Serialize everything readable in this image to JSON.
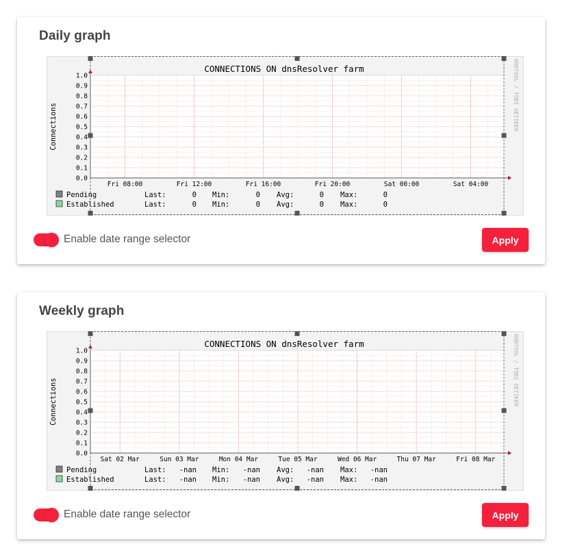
{
  "panels": [
    {
      "title": "Daily graph",
      "graph_title": "CONNECTIONS ON dnsResolver farm",
      "ylabel": "Connections",
      "watermark": "RRDTOOL / TOBI OETIKER",
      "toggle_label": "Enable date range selector",
      "toggle_on": true,
      "apply_label": "Apply",
      "legend": [
        {
          "name": "Pending",
          "color": "#808080",
          "last_label": "Last:",
          "last": "0",
          "min_label": "Min:",
          "min": "0",
          "avg_label": "Avg:",
          "avg": "0",
          "max_label": "Max:",
          "max": "0"
        },
        {
          "name": "Established",
          "color": "#88d8a0",
          "last_label": "Last:",
          "last": "0",
          "min_label": "Min:",
          "min": "0",
          "avg_label": "Avg:",
          "avg": "0",
          "max_label": "Max:",
          "max": "0"
        }
      ]
    },
    {
      "title": "Weekly graph",
      "graph_title": "CONNECTIONS ON dnsResolver farm",
      "ylabel": "Connections",
      "watermark": "RRDTOOL / TOBI OETIKER",
      "toggle_label": "Enable date range selector",
      "toggle_on": true,
      "apply_label": "Apply",
      "legend": [
        {
          "name": "Pending",
          "color": "#808080",
          "last_label": "Last:",
          "last": "-nan",
          "min_label": "Min:",
          "min": "-nan",
          "avg_label": "Avg:",
          "avg": "-nan",
          "max_label": "Max:",
          "max": "-nan"
        },
        {
          "name": "Established",
          "color": "#88d8a0",
          "last_label": "Last:",
          "last": "-nan",
          "min_label": "Min:",
          "min": "-nan",
          "avg_label": "Avg:",
          "avg": "-nan",
          "max_label": "Max:",
          "max": "-nan"
        }
      ]
    }
  ],
  "chart_data": [
    {
      "type": "area",
      "title": "CONNECTIONS ON dnsResolver farm",
      "ylabel": "Connections",
      "xlabel": "",
      "ylim": [
        0,
        1
      ],
      "yticks": [
        "0.0",
        "0.1",
        "0.2",
        "0.3",
        "0.4",
        "0.5",
        "0.6",
        "0.7",
        "0.8",
        "0.9",
        "1.0"
      ],
      "xticks": [
        "Fri 08:00",
        "Fri 12:00",
        "Fri 16:00",
        "Fri 20:00",
        "Sat 00:00",
        "Sat 04:00"
      ],
      "series": [
        {
          "name": "Pending",
          "color": "#808080",
          "values": []
        },
        {
          "name": "Established",
          "color": "#88d8a0",
          "values": []
        }
      ],
      "grid": true,
      "legend_position": "bottom"
    },
    {
      "type": "area",
      "title": "CONNECTIONS ON dnsResolver farm",
      "ylabel": "Connections",
      "xlabel": "",
      "ylim": [
        0,
        1
      ],
      "yticks": [
        "0.0",
        "0.1",
        "0.2",
        "0.3",
        "0.4",
        "0.5",
        "0.6",
        "0.7",
        "0.8",
        "0.9",
        "1.0"
      ],
      "xticks": [
        "Sat 02 Mar",
        "Sun 03 Mar",
        "Mon 04 Mar",
        "Tue 05 Mar",
        "Wed 06 Mar",
        "Thu 07 Mar",
        "Fri 08 Mar"
      ],
      "series": [
        {
          "name": "Pending",
          "color": "#808080",
          "values": []
        },
        {
          "name": "Established",
          "color": "#88d8a0",
          "values": []
        }
      ],
      "grid": true,
      "legend_position": "bottom"
    }
  ]
}
